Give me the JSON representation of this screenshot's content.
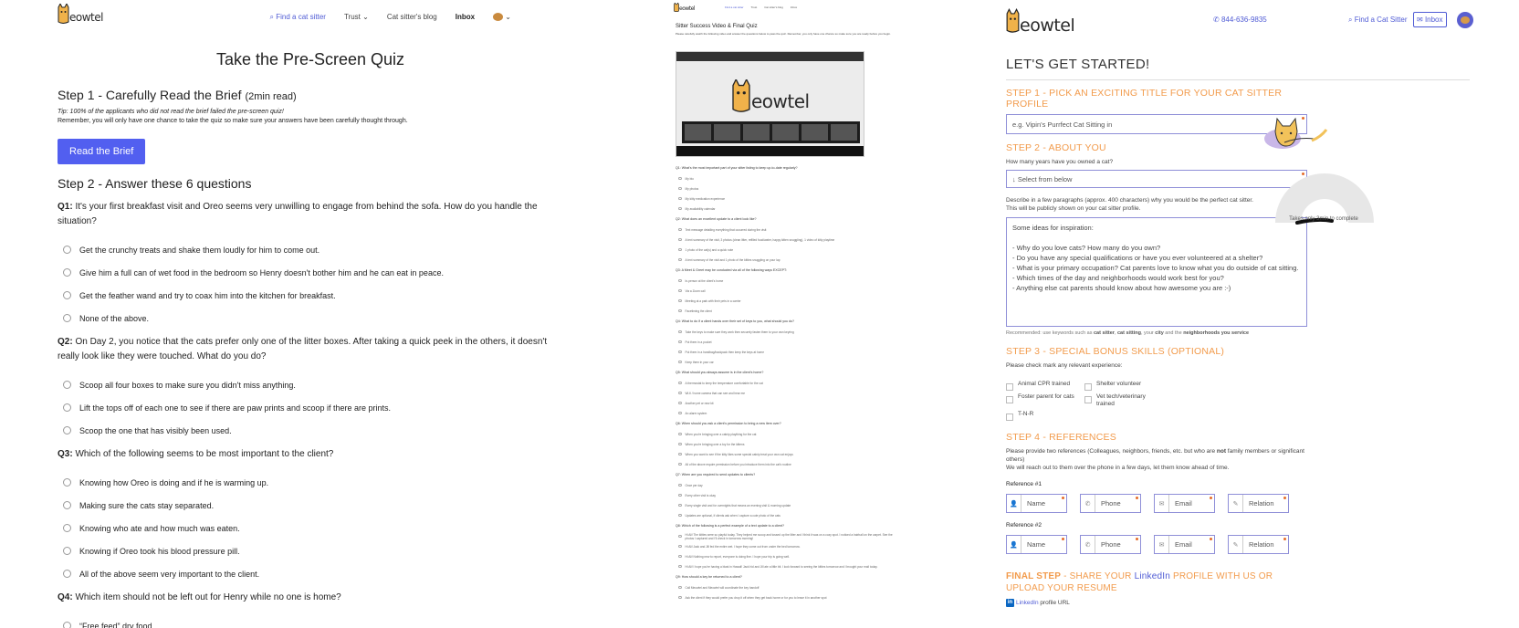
{
  "brand": {
    "logo_text": "eowtel"
  },
  "quiz": {
    "nav": {
      "find": "Find a cat sitter",
      "trust": "Trust",
      "blog": "Cat sitter's blog",
      "inbox": "Inbox"
    },
    "title": "Take the Pre-Screen Quiz",
    "step1": {
      "title": "Step 1 - Carefully Read the Brief",
      "duration": "(2min read)",
      "tip": "Tip: 100% of the applicants who did not read the brief failed the pre-screen quiz!",
      "remember": "Remember, you will only have one chance to take the quiz so make sure your answers have been carefully thought through.",
      "button": "Read the Brief"
    },
    "step2": {
      "title": "Step 2 - Answer these 6 questions"
    },
    "questions": [
      {
        "num": "Q1:",
        "text": "It's your first breakfast visit and Oreo seems very unwilling to engage from behind the sofa. How do you handle the situation?",
        "options": [
          "Get the crunchy treats and shake them loudly for him to come out.",
          "Give him a full can of wet food in the bedroom so Henry doesn't bother him and he can eat in peace.",
          "Get the feather wand and try to coax him into the kitchen for breakfast.",
          "None of the above."
        ]
      },
      {
        "num": "Q2:",
        "text": "On Day 2, you notice that the cats prefer only one of the litter boxes. After taking a quick peek in the others, it doesn't really look like they were touched. What do you do?",
        "options": [
          "Scoop all four boxes to make sure you didn't miss anything.",
          "Lift the tops off of each one to see if there are paw prints and scoop if there are prints.",
          "Scoop the one that has visibly been used."
        ]
      },
      {
        "num": "Q3:",
        "text": "Which of the following seems to be most important to the client?",
        "options": [
          "Knowing how Oreo is doing and if he is warming up.",
          "Making sure the cats stay separated.",
          "Knowing who ate and how much was eaten.",
          "Knowing if Oreo took his blood pressure pill.",
          "All of the above seem very important to the client."
        ]
      },
      {
        "num": "Q4:",
        "text": "Which item should not be left out for Henry while no one is home?",
        "options": [
          "“Free feed” dry food."
        ]
      }
    ]
  },
  "video_quiz": {
    "nav": {
      "find": "Find a cat sitter",
      "trust": "Trust",
      "blog": "Cat sitter's blog",
      "inbox": "Inbox"
    },
    "title": "Sitter Success Video & Final Quiz",
    "intro": "Please carefully watch the following video and answer the questions below to pass the quiz. Remember, you only have one chance so make sure you are ready before you begin.",
    "questions": [
      {
        "text": "Q1: What's the most important part of your sitter listing to keep up-to-date regularly?",
        "options": [
          "My bio",
          "My photos",
          "My kitty medication experience",
          "My availability calendar"
        ]
      },
      {
        "text": "Q2: What does an excellent update to a client look like?",
        "options": [
          "Text message detailing everything that occurred during the visit",
          "A text summary of the visit, 3 photos (clean litter, refilled food/water, happy kitten snuggling), 1 video of kitty playtime",
          "1 photo of the cat(s) and a quick note",
          "A text summary of the visit and 1 photo of the kitties snuggling on your lap"
        ]
      },
      {
        "text": "Q3: A Meet & Greet may be conducted via all of the following ways EXCEPT:",
        "options": [
          "In-person at the client's home",
          "Via a Zoom call",
          "Meeting at a park with their pets in a carrier",
          "Facetiming the client"
        ]
      },
      {
        "text": "Q4: What to do if a client hands over their set of keys to you, what should you do?",
        "options": [
          "Take the keys to make sure they work then securely fasten them to your own keyring",
          "Put them in a pocket",
          "Put them in a handbag/backpack then keep the keys at home",
          "Keep them in your car"
        ]
      },
      {
        "text": "Q5: What should you always assume is in the client's home?",
        "options": [
          "A thermostat to keep the temperature comfortable for the cat",
          "Wi-fi / home camera that can see and hear me",
          "Another pet or new kit",
          "An alarm system"
        ]
      },
      {
        "text": "Q6: When should you ask a client's permission to bring a new item over?",
        "options": [
          "When you're bringing over a catnip plaything for the cat",
          "When you're bringing over a toy for the kittens",
          "When you want to see if the kitty likes some special catnip treat your own cat enjoys",
          "All of the above require permission before you introduce them into the cat's routine"
        ]
      },
      {
        "text": "Q7: When are you required to send updates to clients?",
        "options": [
          "Once per day",
          "Every other visit is okay",
          "Every single visit and for overnights that means an evening visit & morning update",
          "Updates are optional, if clients ask when I capture a cute photo of the cats"
        ]
      },
      {
        "text": "Q8: Which of the following is a perfect example of a text update to a client?",
        "options": [
          "Hi Ali! The kitties were so playful today. They helped me scoop and tossed up the litter and I think it was on a cozy spot. I noticed a hairball on the carpet. See the photos I captured and I'll check in tomorrow morning!",
          "Hi Ali! Jack and Jill fed the entire wet. I hope they come out from under the bed tomorrow.",
          "Hi Ali! Nothing new to report, everyone is doing fine. I hope your trip is going well.",
          "Hi Ali! I hope you're having a blast in Hawaii! Jack hid and Jill ate a little bit. I look forward to seeing the kitties tomorrow and I brought your mail today."
        ]
      },
      {
        "text": "Q9: How should a key be returned to a client?",
        "options": [
          "Call Meowtel and Meowtel will coordinate the key handoff",
          "Ask the client if they would prefer you drop it off when they get back home or for you to leave it in another spot"
        ]
      }
    ]
  },
  "signup": {
    "nav": {
      "phone": "844-636-9835",
      "find": "Find a Cat Sitter",
      "inbox": "Inbox"
    },
    "header": "LET'S GET STARTED!",
    "step1": {
      "prefix": "STEP 1",
      "title": " - PICK AN EXCITING TITLE FOR YOUR CAT SITTER PROFILE",
      "placeholder": "e.g. Vipin's Purrfect Cat Sitting in"
    },
    "step2": {
      "prefix": "STEP 2",
      "title": " - ABOUT YOU",
      "years_label": "How many years have you owned a cat?",
      "select": "↓ Select from below",
      "describe": "Describe in a few paragraphs (approx. 400 characters) why you would be the perfect cat sitter.",
      "public_note": "This will be publicly shown on your cat sitter profile.",
      "textarea": "Some ideas for inspiration:\n\n- Why do you love cats? How many do you own?\n- Do you have any special qualifications or have you ever volunteered at a shelter?\n- What is your primary occupation? Cat parents love to know what you do outside of cat sitting.\n- Which times of the day and neighborhoods would work best for you?\n- Anything else cat parents should know about how awesome you are :-)",
      "rec_a": "Recommended: use keywords such as ",
      "rec_b": "cat sitter",
      "rec_c": ", ",
      "rec_d": "cat sitting",
      "rec_e": ", your ",
      "rec_f": "city",
      "rec_g": " and the ",
      "rec_h": "neighborhoods you service"
    },
    "step3": {
      "prefix": "STEP 3",
      "title": " - SPECIAL BONUS SKILLS (OPTIONAL)",
      "label": "Please check mark any relevant experience:",
      "skills": [
        "Animal CPR trained",
        "Shelter volunteer",
        "Foster parent for cats",
        "Vet tech/veterinary trained",
        "T-N-R"
      ]
    },
    "step4": {
      "prefix": "STEP 4",
      "title": " - REFERENCES",
      "text_a": "Please provide two references (Colleagues, neighbors, friends, etc. but who are ",
      "text_not": "not",
      "text_b": " family members or significant others)",
      "text_c": "We will reach out to them over the phone in a few days, let them know ahead of time.",
      "ref1": "Reference #1",
      "ref2": "Reference #2",
      "fields": [
        "Name",
        "Phone",
        "Email",
        "Relation"
      ]
    },
    "final": {
      "prefix": "FINAL STEP",
      "title_a": " - SHARE YOUR ",
      "linkedin": "LinkedIn",
      "title_b": " PROFILE WITH US OR UPLOAD YOUR RESUME",
      "url_label_a": "LinkedIn",
      "url_label_b": " profile URL"
    },
    "gauge_note": "Takes only 3min to complete",
    "colors": {
      "accent": "#4f5bd5",
      "orange": "#f29b4c",
      "button": "#525ff0"
    }
  }
}
